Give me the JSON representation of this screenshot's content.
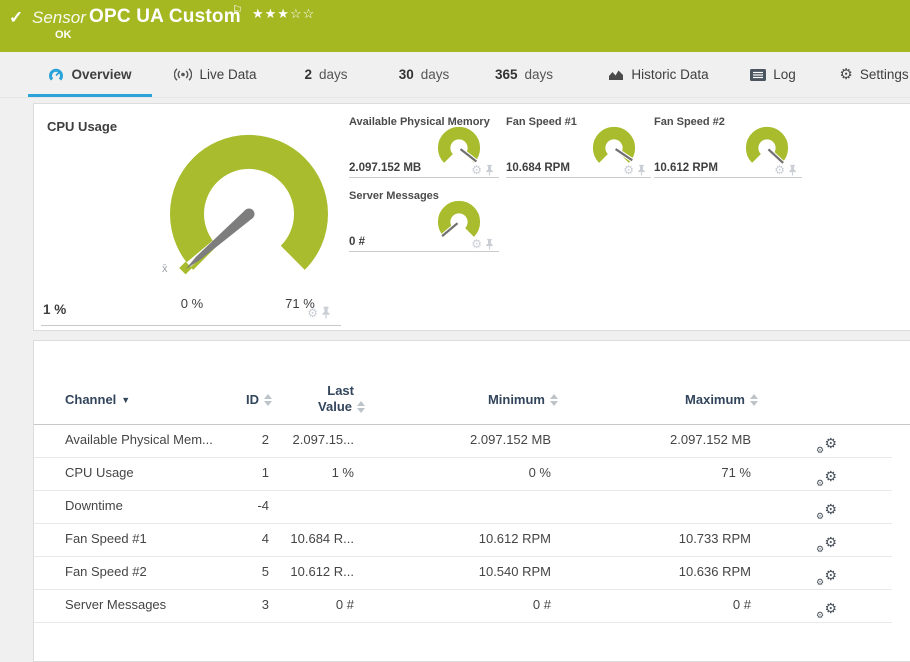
{
  "header": {
    "check_icon": "✓",
    "sensor_label": "Sensor",
    "title": "OPC UA Custom",
    "flag_icon": "⚐",
    "stars_filled": "★★★",
    "stars_empty": "☆☆",
    "status": "OK",
    "bg_color": "#a5b822"
  },
  "tabs": {
    "overview": "Overview",
    "live_data": "Live Data",
    "d2_num": "2",
    "d2_label": "days",
    "d30_num": "30",
    "d30_label": "days",
    "d365_num": "365",
    "d365_label": "days",
    "historic": "Historic Data",
    "log": "Log",
    "settings": "Settings",
    "gear_glyph": "⚙"
  },
  "gauges": {
    "cpu": {
      "title": "CPU Usage",
      "value": "1 %",
      "scale_min": "0 %",
      "scale_max": "71 %",
      "avg_marker": "x̄",
      "numeric_value": 1,
      "numeric_min": 0,
      "numeric_max": 71,
      "unit": "%"
    },
    "memory": {
      "title": "Available Physical Memory",
      "value": "2.097.152 MB",
      "numeric_value": 2097152,
      "unit": "MB"
    },
    "fan1": {
      "title": "Fan Speed #1",
      "value": "10.684 RPM",
      "numeric_value": 10684,
      "unit": "RPM"
    },
    "fan2": {
      "title": "Fan Speed #2",
      "value": "10.612 RPM",
      "numeric_value": 10612,
      "unit": "RPM"
    },
    "messages": {
      "title": "Server Messages",
      "value": "0 #",
      "numeric_value": 0,
      "unit": "#"
    },
    "gear_glyph": "⚙",
    "gauge_color": "#a8bc2d"
  },
  "channel_table": {
    "headers": {
      "channel": "Channel",
      "id": "ID",
      "last_line1": "Last",
      "last_line2": "Value",
      "minimum": "Minimum",
      "maximum": "Maximum"
    },
    "rows": [
      {
        "channel": "Available Physical Mem...",
        "id": "2",
        "last": "2.097.15...",
        "min": "2.097.152 MB",
        "max": "2.097.152 MB"
      },
      {
        "channel": "CPU Usage",
        "id": "1",
        "last": "1 %",
        "min": "0 %",
        "max": "71 %"
      },
      {
        "channel": "Downtime",
        "id": "-4",
        "last": "",
        "min": "",
        "max": ""
      },
      {
        "channel": "Fan Speed #1",
        "id": "4",
        "last": "10.684 R...",
        "min": "10.612 RPM",
        "max": "10.733 RPM"
      },
      {
        "channel": "Fan Speed #2",
        "id": "5",
        "last": "10.612 R...",
        "min": "10.540 RPM",
        "max": "10.636 RPM"
      },
      {
        "channel": "Server Messages",
        "id": "3",
        "last": "0 #",
        "min": "0 #",
        "max": "0 #"
      }
    ],
    "gears_glyph": "⚙"
  },
  "colors": {
    "brand_green": "#a5b822",
    "gauge_green": "#a8bc2d",
    "active_tab_blue": "#29a3d8"
  }
}
